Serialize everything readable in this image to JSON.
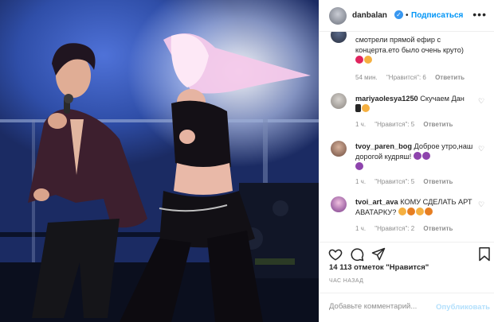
{
  "header": {
    "username": "danbalan",
    "separator": "•",
    "follow_label": "Подписаться",
    "more_icon": "more-horizontal-icon"
  },
  "comments": [
    {
      "username": "",
      "text": "смотрели прямой ефир с концерта.ето было очень круто)",
      "emojis": [
        "heart",
        "smile"
      ],
      "time": "54 мин.",
      "likes": "\"Нравится\": 6",
      "reply": "Ответить"
    },
    {
      "username": "mariyaolesya1250",
      "text": "Скучаем Дан",
      "emojis": [
        "black-heart",
        "smile"
      ],
      "time": "1 ч.",
      "likes": "\"Нравится\": 5",
      "reply": "Ответить"
    },
    {
      "username": "tvoy_paren_bog",
      "text": "Доброе утро,наш дорогой кудряш!",
      "emojis": [
        "purple-heart",
        "purple-heart",
        "purple-heart"
      ],
      "time": "1 ч.",
      "likes": "\"Нравится\": 5",
      "reply": "Ответить"
    },
    {
      "username": "tvoi_art_ava",
      "text": "КОМУ СДЕЛАТЬ АРТ АВАТАРКУ?",
      "emojis": [
        "smile",
        "fire",
        "smile",
        "fire"
      ],
      "time": "1 ч.",
      "likes": "\"Нравится\": 2",
      "reply": "Ответить"
    }
  ],
  "actions": {
    "like_icon": "heart-icon",
    "comment_icon": "comment-icon",
    "share_icon": "share-icon",
    "save_icon": "bookmark-icon"
  },
  "likes_text": "14 113 отметок \"Нравится\"",
  "posted_text": "ЧАС НАЗАД",
  "add_comment": {
    "placeholder": "Добавьте комментарий...",
    "publish_label": "Опубликовать"
  },
  "colors": {
    "accent": "#0095f6",
    "publish_disabled": "#b2dffc",
    "meta_gray": "#8e8e8e"
  }
}
